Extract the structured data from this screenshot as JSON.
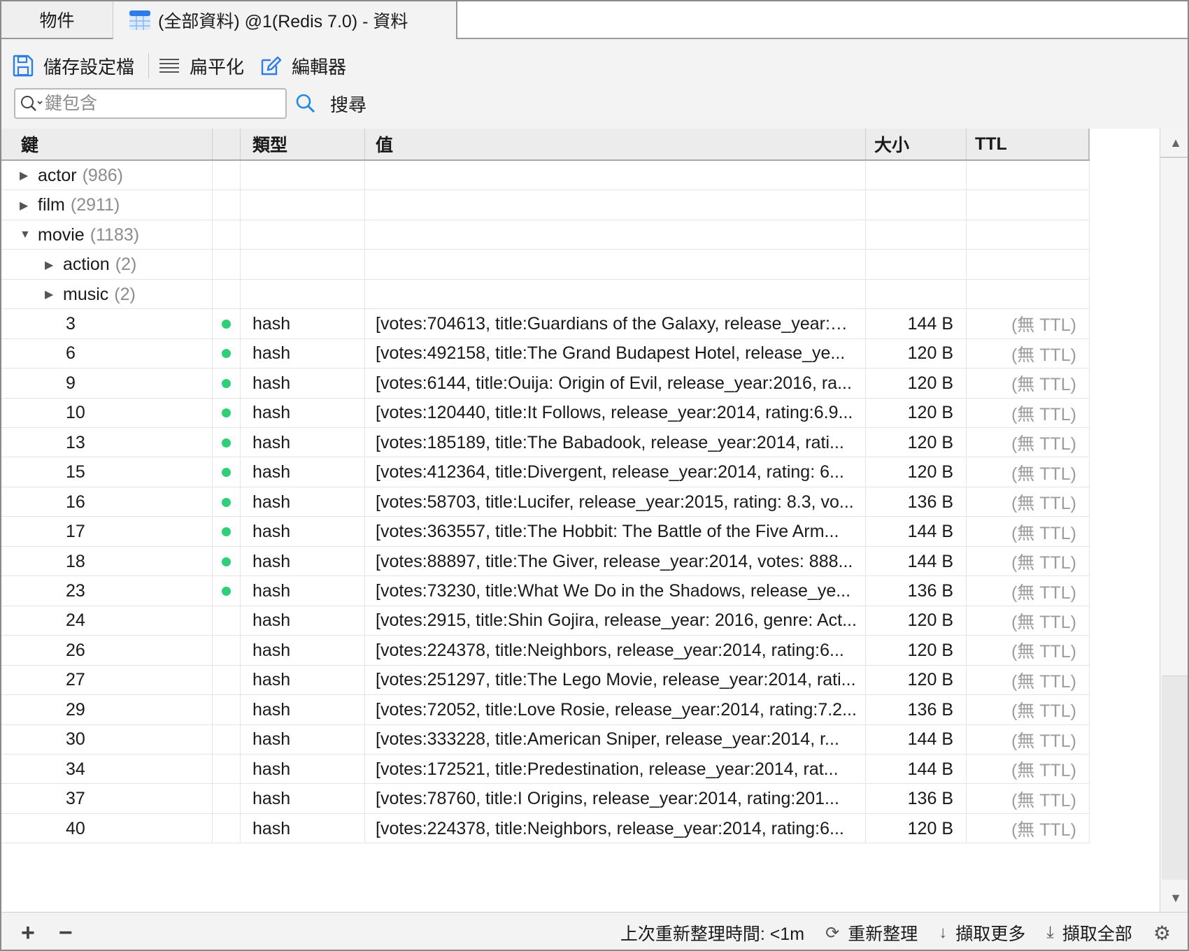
{
  "tabs": {
    "objects_label": "物件",
    "data_label": "(全部資料) @1(Redis 7.0) - 資料"
  },
  "toolbar": {
    "save_label": "儲存設定檔",
    "flatten_label": "扁平化",
    "editor_label": "編輯器",
    "search_placeholder": "鍵包含",
    "search_label": "搜尋"
  },
  "columns": {
    "key": "鍵",
    "type": "類型",
    "value": "值",
    "size": "大小",
    "ttl": "TTL"
  },
  "groups": [
    {
      "name": "actor",
      "count": "(986)",
      "expanded": false
    },
    {
      "name": "film",
      "count": "(2911)",
      "expanded": false
    },
    {
      "name": "movie",
      "count": "(1183)",
      "expanded": true
    },
    {
      "name": "action",
      "count": "(2)",
      "expanded": false
    },
    {
      "name": "music",
      "count": "(2)",
      "expanded": false
    }
  ],
  "rows": [
    {
      "key": "3",
      "type": "hash",
      "value": "[votes:704613, title:Guardians of the Galaxy, release_year:…",
      "size": "144 B",
      "ttl": "(無 TTL)",
      "dot": true
    },
    {
      "key": "6",
      "type": "hash",
      "value": "[votes:492158, title:The Grand Budapest Hotel, release_ye...",
      "size": "120 B",
      "ttl": "(無 TTL)",
      "dot": true
    },
    {
      "key": "9",
      "type": "hash",
      "value": "[votes:6144, title:Ouija: Origin of Evil, release_year:2016, ra...",
      "size": "120 B",
      "ttl": "(無 TTL)",
      "dot": true
    },
    {
      "key": "10",
      "type": "hash",
      "value": "[votes:120440, title:It Follows, release_year:2014, rating:6.9...",
      "size": "120 B",
      "ttl": "(無 TTL)",
      "dot": true
    },
    {
      "key": "13",
      "type": "hash",
      "value": "[votes:185189, title:The Babadook, release_year:2014, rati...",
      "size": "120 B",
      "ttl": "(無 TTL)",
      "dot": true
    },
    {
      "key": "15",
      "type": "hash",
      "value": "[votes:412364, title:Divergent, release_year:2014, rating: 6...",
      "size": "120 B",
      "ttl": "(無 TTL)",
      "dot": true
    },
    {
      "key": "16",
      "type": "hash",
      "value": "[votes:58703, title:Lucifer, release_year:2015, rating: 8.3, vo...",
      "size": "136 B",
      "ttl": "(無 TTL)",
      "dot": true
    },
    {
      "key": "17",
      "type": "hash",
      "value": "[votes:363557, title:The Hobbit: The Battle of the Five Arm...",
      "size": "144 B",
      "ttl": "(無 TTL)",
      "dot": true
    },
    {
      "key": "18",
      "type": "hash",
      "value": "[votes:88897, title:The Giver, release_year:2014, votes: 888...",
      "size": "144 B",
      "ttl": "(無 TTL)",
      "dot": true
    },
    {
      "key": "23",
      "type": "hash",
      "value": "[votes:73230, title:What We Do in the Shadows, release_ye...",
      "size": "136 B",
      "ttl": "(無 TTL)",
      "dot": true
    },
    {
      "key": "24",
      "type": "hash",
      "value": "[votes:2915, title:Shin Gojira, release_year: 2016, genre: Act...",
      "size": "120 B",
      "ttl": "(無 TTL)",
      "dot": false
    },
    {
      "key": "26",
      "type": "hash",
      "value": "[votes:224378, title:Neighbors, release_year:2014, rating:6...",
      "size": "120 B",
      "ttl": "(無 TTL)",
      "dot": false
    },
    {
      "key": "27",
      "type": "hash",
      "value": "[votes:251297, title:The Lego Movie, release_year:2014, rati...",
      "size": "120 B",
      "ttl": "(無 TTL)",
      "dot": false
    },
    {
      "key": "29",
      "type": "hash",
      "value": "[votes:72052, title:Love Rosie, release_year:2014, rating:7.2...",
      "size": "136 B",
      "ttl": "(無 TTL)",
      "dot": false
    },
    {
      "key": "30",
      "type": "hash",
      "value": "[votes:333228, title:American Sniper, release_year:2014, r...",
      "size": "144 B",
      "ttl": "(無 TTL)",
      "dot": false
    },
    {
      "key": "34",
      "type": "hash",
      "value": "[votes:172521, title:Predestination, release_year:2014, rat...",
      "size": "144 B",
      "ttl": "(無 TTL)",
      "dot": false
    },
    {
      "key": "37",
      "type": "hash",
      "value": "[votes:78760, title:I Origins, release_year:2014, rating:201...",
      "size": "136 B",
      "ttl": "(無 TTL)",
      "dot": false
    },
    {
      "key": "40",
      "type": "hash",
      "value": "[votes:224378, title:Neighbors, release_year:2014, rating:6...",
      "size": "120 B",
      "ttl": "(無 TTL)",
      "dot": false
    }
  ],
  "statusbar": {
    "add_label": "+",
    "remove_label": "−",
    "refresh_time": "上次重新整理時間: <1m",
    "refresh_label": "重新整理",
    "fetch_more_label": "擷取更多",
    "fetch_all_label": "擷取全部"
  },
  "colors": {
    "dot": "#2fcf7a",
    "accent": "#1e88e5"
  }
}
